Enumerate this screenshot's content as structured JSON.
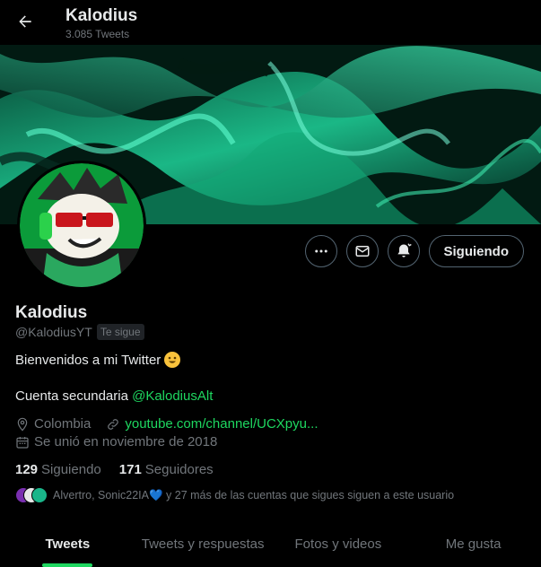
{
  "header": {
    "back_icon": "arrow-left-icon",
    "name": "Kalodius",
    "tweet_count": "3.085 Tweets"
  },
  "profile": {
    "name": "Kalodius",
    "handle": "@KalodiusYT",
    "follows_you_badge": "Te sigue",
    "bio_line1": "Bienvenidos a mi Twitter",
    "bio_line2_text": "Cuenta secundaria ",
    "bio_line2_mention": "@KalodiusAlt",
    "location": "Colombia",
    "website": "youtube.com/channel/UCXpyu...",
    "joined": "Se unió en noviembre de 2018",
    "following_count": "129",
    "following_label": "Siguiendo",
    "followers_count": "171",
    "followers_label": "Seguidores",
    "followed_by_text": "Alvertro, Sonic22IA💙 y 27 más de las cuentas que sigues siguen a este usuario"
  },
  "actions": {
    "more_icon": "more-icon",
    "message_icon": "message-icon",
    "notify_icon": "bell-icon",
    "follow_label": "Siguiendo"
  },
  "tabs": [
    {
      "label": "Tweets",
      "active": true
    },
    {
      "label": "Tweets y respuestas",
      "active": false
    },
    {
      "label": "Fotos y videos",
      "active": false
    },
    {
      "label": "Me gusta",
      "active": false
    }
  ],
  "colors": {
    "accent": "#1ed760",
    "link": "#1d9bf0",
    "muted": "#71767b"
  }
}
